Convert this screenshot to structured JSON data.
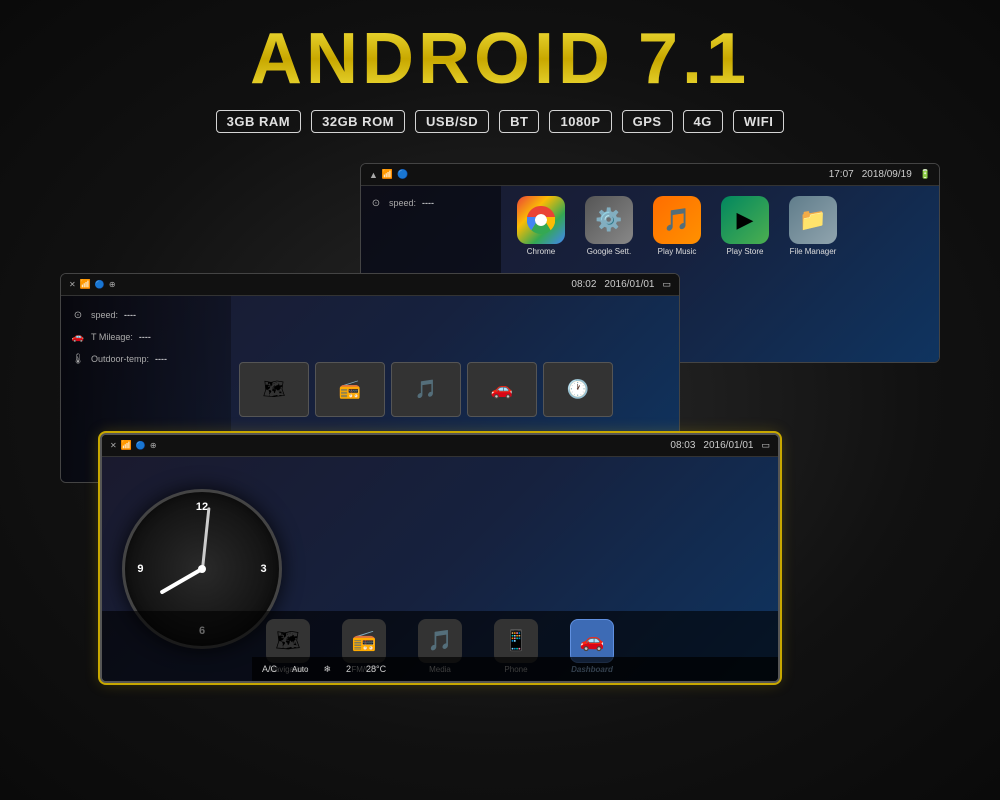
{
  "title": "ANDROID 7.1",
  "specs": [
    {
      "label": "3GB RAM"
    },
    {
      "label": "32GB ROM"
    },
    {
      "label": "USB/SD"
    },
    {
      "label": "BT"
    },
    {
      "label": "1080P"
    },
    {
      "label": "GPS"
    },
    {
      "label": "4G"
    },
    {
      "label": "WIFI"
    }
  ],
  "screens": {
    "back": {
      "time": "17:07",
      "date": "2018/09/19",
      "apps": [
        {
          "name": "Chrome",
          "icon": "chrome"
        },
        {
          "name": "Google Sett.",
          "icon": "gsettings"
        },
        {
          "name": "Play Music",
          "icon": "playmusic"
        },
        {
          "name": "Play Store",
          "icon": "playstore"
        },
        {
          "name": "File Manager",
          "icon": "filemanager"
        }
      ],
      "speed_label": "speed:",
      "speed_value": "----"
    },
    "mid": {
      "time": "08:02",
      "date": "2016/01/01",
      "speed_label": "speed:",
      "speed_value": "----",
      "mileage_label": "T Mileage:",
      "mileage_value": "----",
      "temp_label": "Outdoor-temp:",
      "temp_value": "----"
    },
    "front": {
      "time": "08:03",
      "date": "2016/01/01",
      "ac_label": "A/C",
      "ac_value": "Auto",
      "fan_value": "2",
      "temp_value": "28°C",
      "nav_apps": [
        {
          "name": "Navigation",
          "active": false
        },
        {
          "name": "FM/CD",
          "active": false
        },
        {
          "name": "Media",
          "active": false
        },
        {
          "name": "Phone",
          "active": false
        },
        {
          "name": "Dashboard",
          "active": true
        }
      ]
    }
  }
}
